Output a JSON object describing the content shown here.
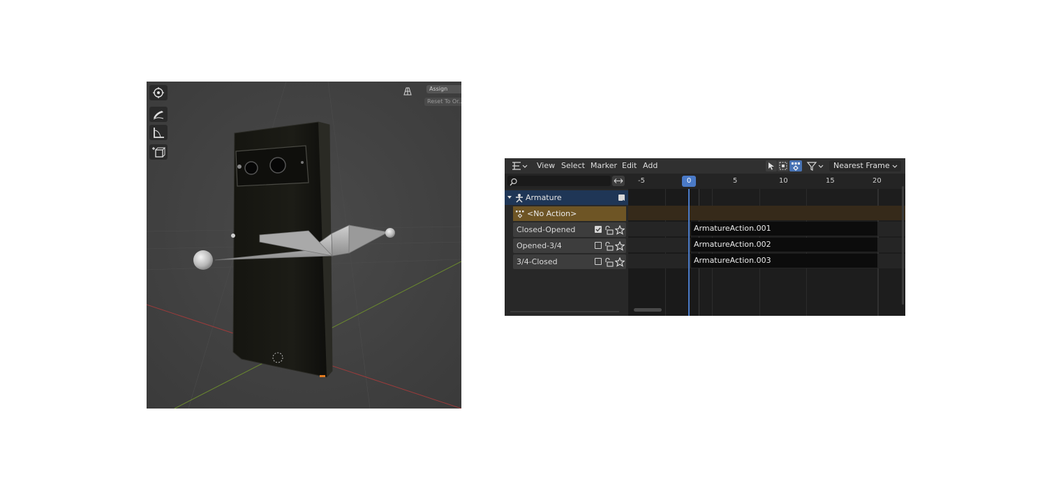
{
  "viewport": {
    "assign_label": "Assign",
    "reset_label": "Reset To Or..",
    "icons": [
      "move-icon",
      "annotate-icon",
      "measure-icon",
      "add-cube-icon",
      "grid-overlay-icon"
    ]
  },
  "nla": {
    "menus": [
      "View",
      "Select",
      "Marker",
      "Edit",
      "Add"
    ],
    "snap_mode": "Nearest Frame",
    "search_placeholder": "",
    "ruler": [
      "-5",
      "0",
      "5",
      "10",
      "15",
      "20"
    ],
    "current_frame": "0",
    "object": {
      "name": "Armature",
      "checked": true
    },
    "action_slot": "<No Action>",
    "tracks": [
      {
        "name": "Closed-Opened",
        "enabled": true,
        "strip": "ArmatureAction.001"
      },
      {
        "name": "Opened-3/4",
        "enabled": false,
        "strip": "ArmatureAction.002"
      },
      {
        "name": "3/4-Closed",
        "enabled": false,
        "strip": "ArmatureAction.003"
      }
    ],
    "colors": {
      "playhead": "#4a7ac7",
      "action_row": "#6e5525",
      "selected_row": "#1f3656"
    }
  }
}
